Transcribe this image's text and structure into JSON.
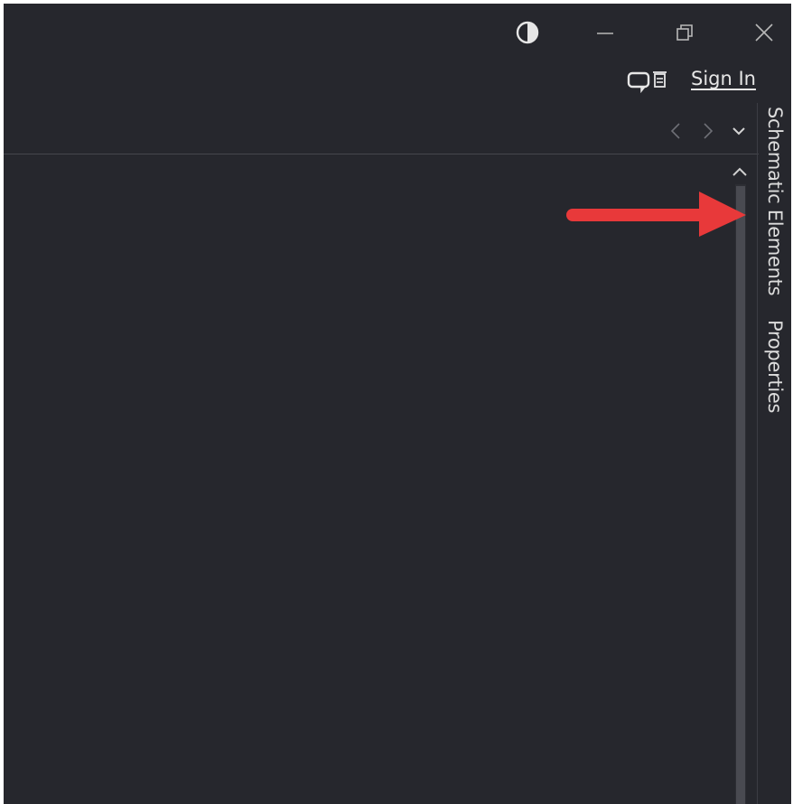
{
  "window_controls": {
    "theme_icon": "contrast-icon",
    "minimize_icon": "minimize-icon",
    "maximize_icon": "restore-icon",
    "close_icon": "close-icon"
  },
  "header": {
    "comm_icon": "communication-center-icon",
    "sign_in_label": "Sign In"
  },
  "navigation": {
    "back_icon": "chevron-left-icon",
    "forward_icon": "chevron-right-icon",
    "menu_icon": "chevron-down-icon"
  },
  "side_tabs": [
    {
      "label": "Schematic Elements"
    },
    {
      "label": "Properties"
    }
  ],
  "scrollbar": {
    "up_icon": "chevron-up-icon"
  },
  "annotation": {
    "icon": "red-arrow-icon",
    "color": "#e8393a"
  },
  "colors": {
    "background": "#26272d",
    "text": "#dcdcdc",
    "accent_arrow": "#e8393a"
  }
}
